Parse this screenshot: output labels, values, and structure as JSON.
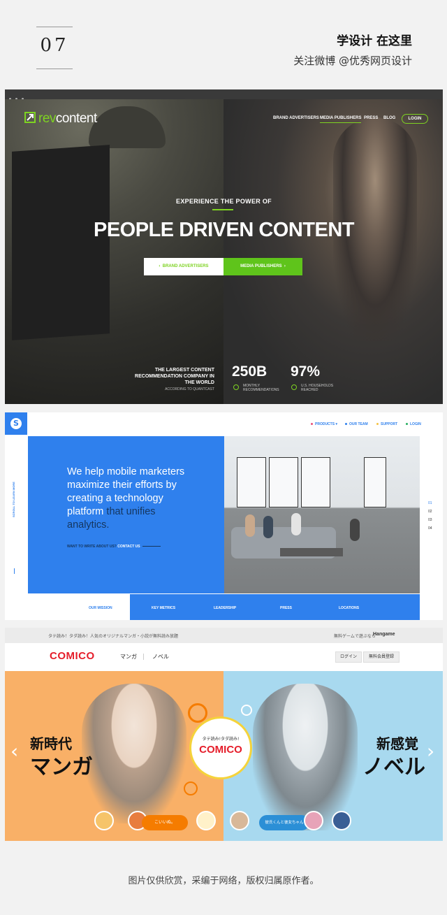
{
  "header": {
    "number": "07",
    "title": "学设计 在这里",
    "subtitle": "关注微博 @优秀网页设计"
  },
  "revcontent": {
    "logo_prefix": "rev",
    "logo_suffix": "content",
    "nav": [
      "BRAND ADVERTISERS",
      "MEDIA PUBLISHERS",
      "PRESS",
      "BLOG"
    ],
    "login": "LOGIN",
    "eyebrow": "EXPERIENCE THE POWER OF",
    "headline": "PEOPLE DRIVEN CONTENT",
    "btn_left": "BRAND ADVERTISERS",
    "btn_right": "MEDIA PUBLISHERS",
    "tagline": "THE LARGEST CONTENT RECOMMENDATION COMPANY IN THE WORLD",
    "source": "ACCORDING TO QUANTCAST",
    "stats": [
      {
        "value": "250B",
        "label": "MONTHLY RECOMMENDATIONS"
      },
      {
        "value": "97%",
        "label": "U.S. HOUSEHOLDS REACHED"
      }
    ],
    "accent": "#7ed321"
  },
  "analytics": {
    "logo_letter": "S",
    "nav": [
      "PRODUCTS",
      "OUR TEAM",
      "SUPPORT",
      "LOGIN"
    ],
    "hero_bright": "We help mobile marketers maximize their efforts by creating a technology platform",
    "hero_dim": "that unifies analytics.",
    "ask": "WANT TO WRITE ABOUT US?",
    "contact": "CONTACT US",
    "scroll": "SCROLL TO LEARN MORE",
    "pager": [
      "01",
      "02",
      "03",
      "04"
    ],
    "tabs": [
      "OUR MISSION",
      "KEY METRICS",
      "LEADERSHIP",
      "PRESS",
      "LOCATIONS"
    ],
    "accent": "#2f80ed"
  },
  "comico": {
    "bar_left": "タテ読み！タダ読み！人気のオリジナルマンガ・小説が無料読み放題",
    "bar_right": "無料ゲームで遊ぶなら",
    "bar_brand": "Hangame",
    "logo": "COMICO",
    "menu": [
      "マンガ",
      "ノベル"
    ],
    "login": "ログイン",
    "register": "無料会員登録",
    "left_small": "新時代",
    "left_big": "マンガ",
    "right_small": "新感覚",
    "right_big": "ノベル",
    "badge_small": "タテ読み!タダ読み!",
    "badge_logo": "COMICO",
    "pill_left": "こいいぬ。",
    "pill_right": "彼氏くんと彼女ちゃん"
  },
  "footer": "图片仅供欣赏，采编于网络，版权归属原作者。"
}
